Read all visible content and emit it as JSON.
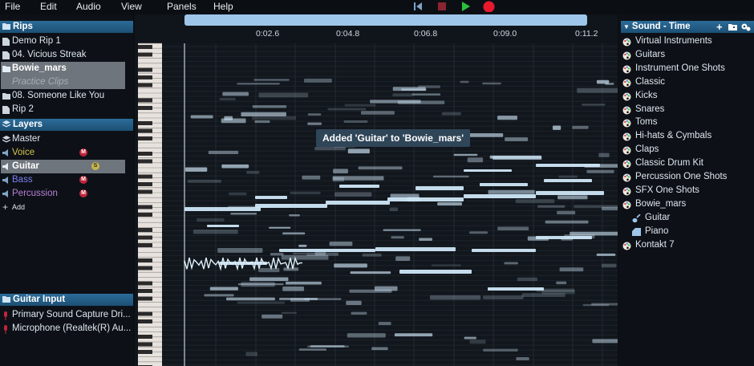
{
  "menu": [
    "File",
    "Edit",
    "Audio",
    "View",
    "Panels",
    "Help"
  ],
  "rips": {
    "title": "Rips",
    "items": [
      {
        "label": "Demo Rip 1",
        "type": "file"
      },
      {
        "label": "04. Vicious Streak",
        "type": "file"
      },
      {
        "label": "Bowie_mars",
        "type": "folder",
        "selected": true
      },
      {
        "label": "Practice Clips",
        "type": "sub"
      },
      {
        "label": "08. Someone Like You",
        "type": "folder"
      },
      {
        "label": "Rip 2",
        "type": "file"
      }
    ]
  },
  "layers": {
    "title": "Layers",
    "items": [
      {
        "label": "Master",
        "color": "#dfe6ee"
      },
      {
        "label": "Voice",
        "color": "#d7c34a",
        "badge": "M",
        "badge_color": "#c0263a"
      },
      {
        "label": "Guitar",
        "color": "#ffffff",
        "badge": "S",
        "badge_color": "#c9b54a",
        "selected": true
      },
      {
        "label": "Bass",
        "color": "#7a7ff0",
        "badge": "M",
        "badge_color": "#c0263a"
      },
      {
        "label": "Percussion",
        "color": "#b97fd9",
        "badge": "M",
        "badge_color": "#c0263a"
      }
    ],
    "add_label": "Add"
  },
  "guitar_input": {
    "title": "Guitar Input",
    "items": [
      "Primary Sound Capture Dri...",
      "Microphone (Realtek(R) Au..."
    ]
  },
  "sound_panel": {
    "title": "Sound - Time",
    "items": [
      {
        "label": "Virtual Instruments"
      },
      {
        "label": "Guitars"
      },
      {
        "label": "Instrument One Shots"
      },
      {
        "label": "Classic"
      },
      {
        "label": "Kicks"
      },
      {
        "label": "Snares"
      },
      {
        "label": "Toms"
      },
      {
        "label": "Hi-hats & Cymbals"
      },
      {
        "label": "Claps"
      },
      {
        "label": "Classic Drum Kit"
      },
      {
        "label": "Percussion One Shots"
      },
      {
        "label": "SFX One Shots"
      },
      {
        "label": "Bowie_mars"
      },
      {
        "label": "Guitar",
        "child": true,
        "icon": "guitar"
      },
      {
        "label": "Piano",
        "child": true,
        "icon": "piano"
      },
      {
        "label": "Kontakt 7"
      }
    ]
  },
  "timeline": {
    "ticks": [
      "0:02.6",
      "0:04.8",
      "0:06.8",
      "0:09.0",
      "0:11.2"
    ]
  },
  "toast": "Added 'Guitar' to 'Bowie_mars'",
  "colors": {
    "accent": "#2c6c99",
    "note": "#cfe6f7",
    "record": "#e8192c",
    "play": "#2bbf3b"
  }
}
